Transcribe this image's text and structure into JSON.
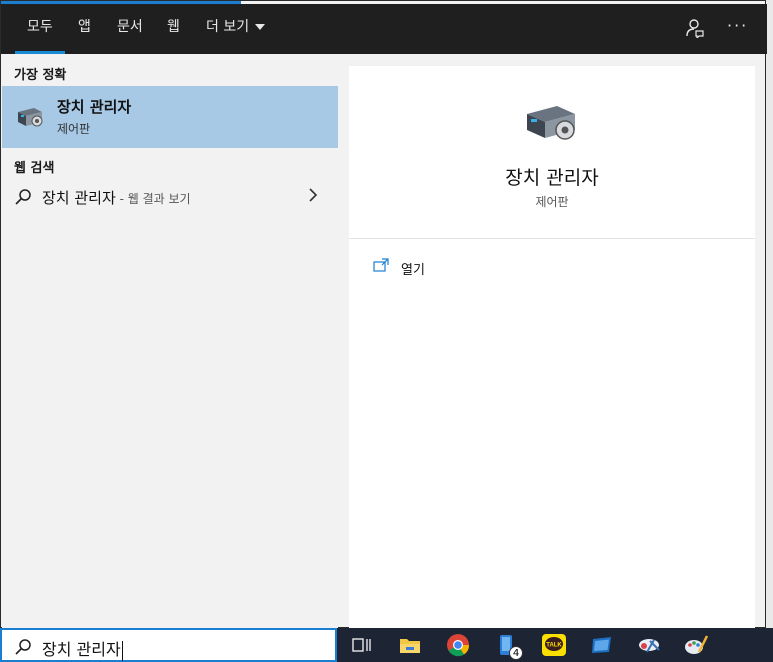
{
  "filter_tabs": {
    "all": "모두",
    "apps": "앱",
    "documents": "문서",
    "web": "웹",
    "more": "더 보기"
  },
  "overflow_label": "···",
  "best_match": {
    "heading": "가장 정확",
    "title": "장치 관리자",
    "subtitle": "제어판"
  },
  "web_search": {
    "heading": "웹 검색",
    "query": "장치 관리자",
    "suffix": " - 웹 결과 보기"
  },
  "detail": {
    "title": "장치 관리자",
    "subtitle": "제어판",
    "actions": [
      {
        "label": "열기",
        "icon": "open-icon"
      }
    ]
  },
  "search_box": {
    "value": "장치 관리자"
  },
  "taskbar": {
    "items": [
      {
        "name": "task-view",
        "icon": "task-view-icon"
      },
      {
        "name": "file-explorer",
        "icon": "folder-icon"
      },
      {
        "name": "chrome",
        "icon": "chrome-icon"
      },
      {
        "name": "phone-app",
        "icon": "phone-icon",
        "badge": "4"
      },
      {
        "name": "kakaotalk",
        "icon": "kakaotalk-icon",
        "label": "TALK"
      },
      {
        "name": "app-blue",
        "icon": "app-icon"
      },
      {
        "name": "snipping",
        "icon": "snip-icon"
      },
      {
        "name": "paint",
        "icon": "paint-icon"
      }
    ]
  },
  "colors": {
    "accent": "#1a7fd1",
    "selection": "#a7c9e6",
    "filter_bar": "#1f1f1f",
    "taskbar": "#1d2433"
  }
}
